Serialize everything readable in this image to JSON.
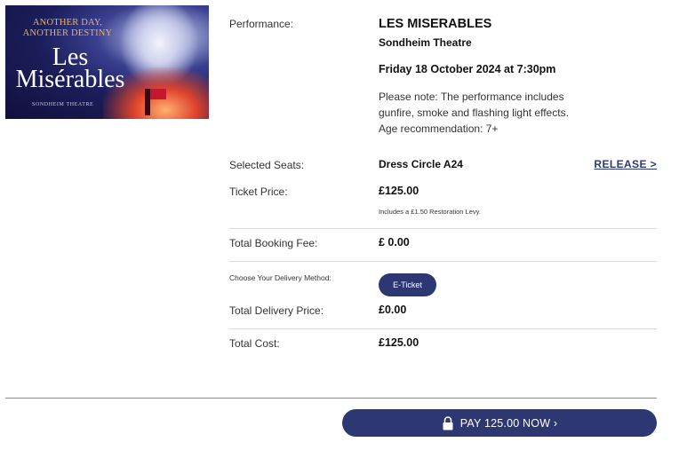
{
  "poster": {
    "tagline_1": "ANOTHER DAY,",
    "tagline_2": "ANOTHER DESTINY",
    "title_1": "Les",
    "title_2": "Misérables",
    "theatre": "SONDHEIM THEATRE"
  },
  "performance": {
    "label": "Performance:",
    "show": "LES MISERABLES",
    "venue": "Sondheim Theatre",
    "date": "Friday 18 October 2024 at 7:30pm",
    "note": "Please note: The performance includes gunfire, smoke and flashing light effects. Age recommendation: 7+"
  },
  "seats": {
    "label": "Selected Seats:",
    "value": "Dress Circle A24",
    "release_label": "RELEASE >"
  },
  "ticket_price": {
    "label": "Ticket Price:",
    "value": "£125.00",
    "levy": "Includes a £1.50 Restoration Levy."
  },
  "booking_fee": {
    "label": "Total Booking Fee:",
    "value": "£ 0.00"
  },
  "delivery": {
    "choose_label": "Choose Your Delivery Method:",
    "method_button": "E-Ticket",
    "price_label": "Total Delivery Price:",
    "price_value": "£0.00"
  },
  "total": {
    "label": "Total Cost:",
    "value": "£125.00"
  },
  "pay_button": {
    "label": "PAY 125.00 NOW ›",
    "icon": "lock-icon"
  },
  "colors": {
    "accent": "#2d3873",
    "link": "#2a3a77"
  }
}
